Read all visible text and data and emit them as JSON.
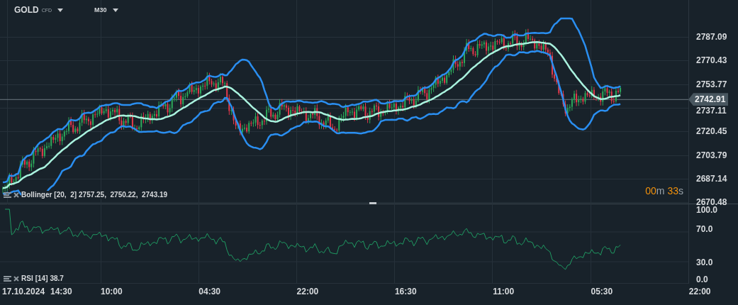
{
  "header": {
    "symbol": "GOLD",
    "symbol_type": "CFD",
    "timeframe": "M30"
  },
  "price_axis": {
    "labels": [
      "2787.09",
      "2770.43",
      "2753.77",
      "2737.11",
      "2720.45",
      "2703.79",
      "2687.14",
      "2670.48"
    ],
    "current_price": "2742.91"
  },
  "countdown": [
    {
      "text": "00",
      "kind": "value"
    },
    {
      "text": "m",
      "kind": "unit"
    },
    {
      "text": " 33",
      "kind": "value"
    },
    {
      "text": "s",
      "kind": "unit"
    }
  ],
  "bollinger": {
    "name": "Bollinger",
    "params": "[20,  2]",
    "values": "2757.25,  2750.22,  2743.19"
  },
  "rsi": {
    "name": "RSI",
    "params": "[14]",
    "value": "38.7",
    "axis_labels": [
      "100.0",
      "70.0",
      "30.0",
      "0.0"
    ]
  },
  "time_axis": {
    "date": "17.10.2024",
    "labels": [
      "14:30",
      "10:00",
      "04:30",
      "22:00",
      "16:30",
      "11:00",
      "05:30",
      "22:00"
    ]
  }
}
